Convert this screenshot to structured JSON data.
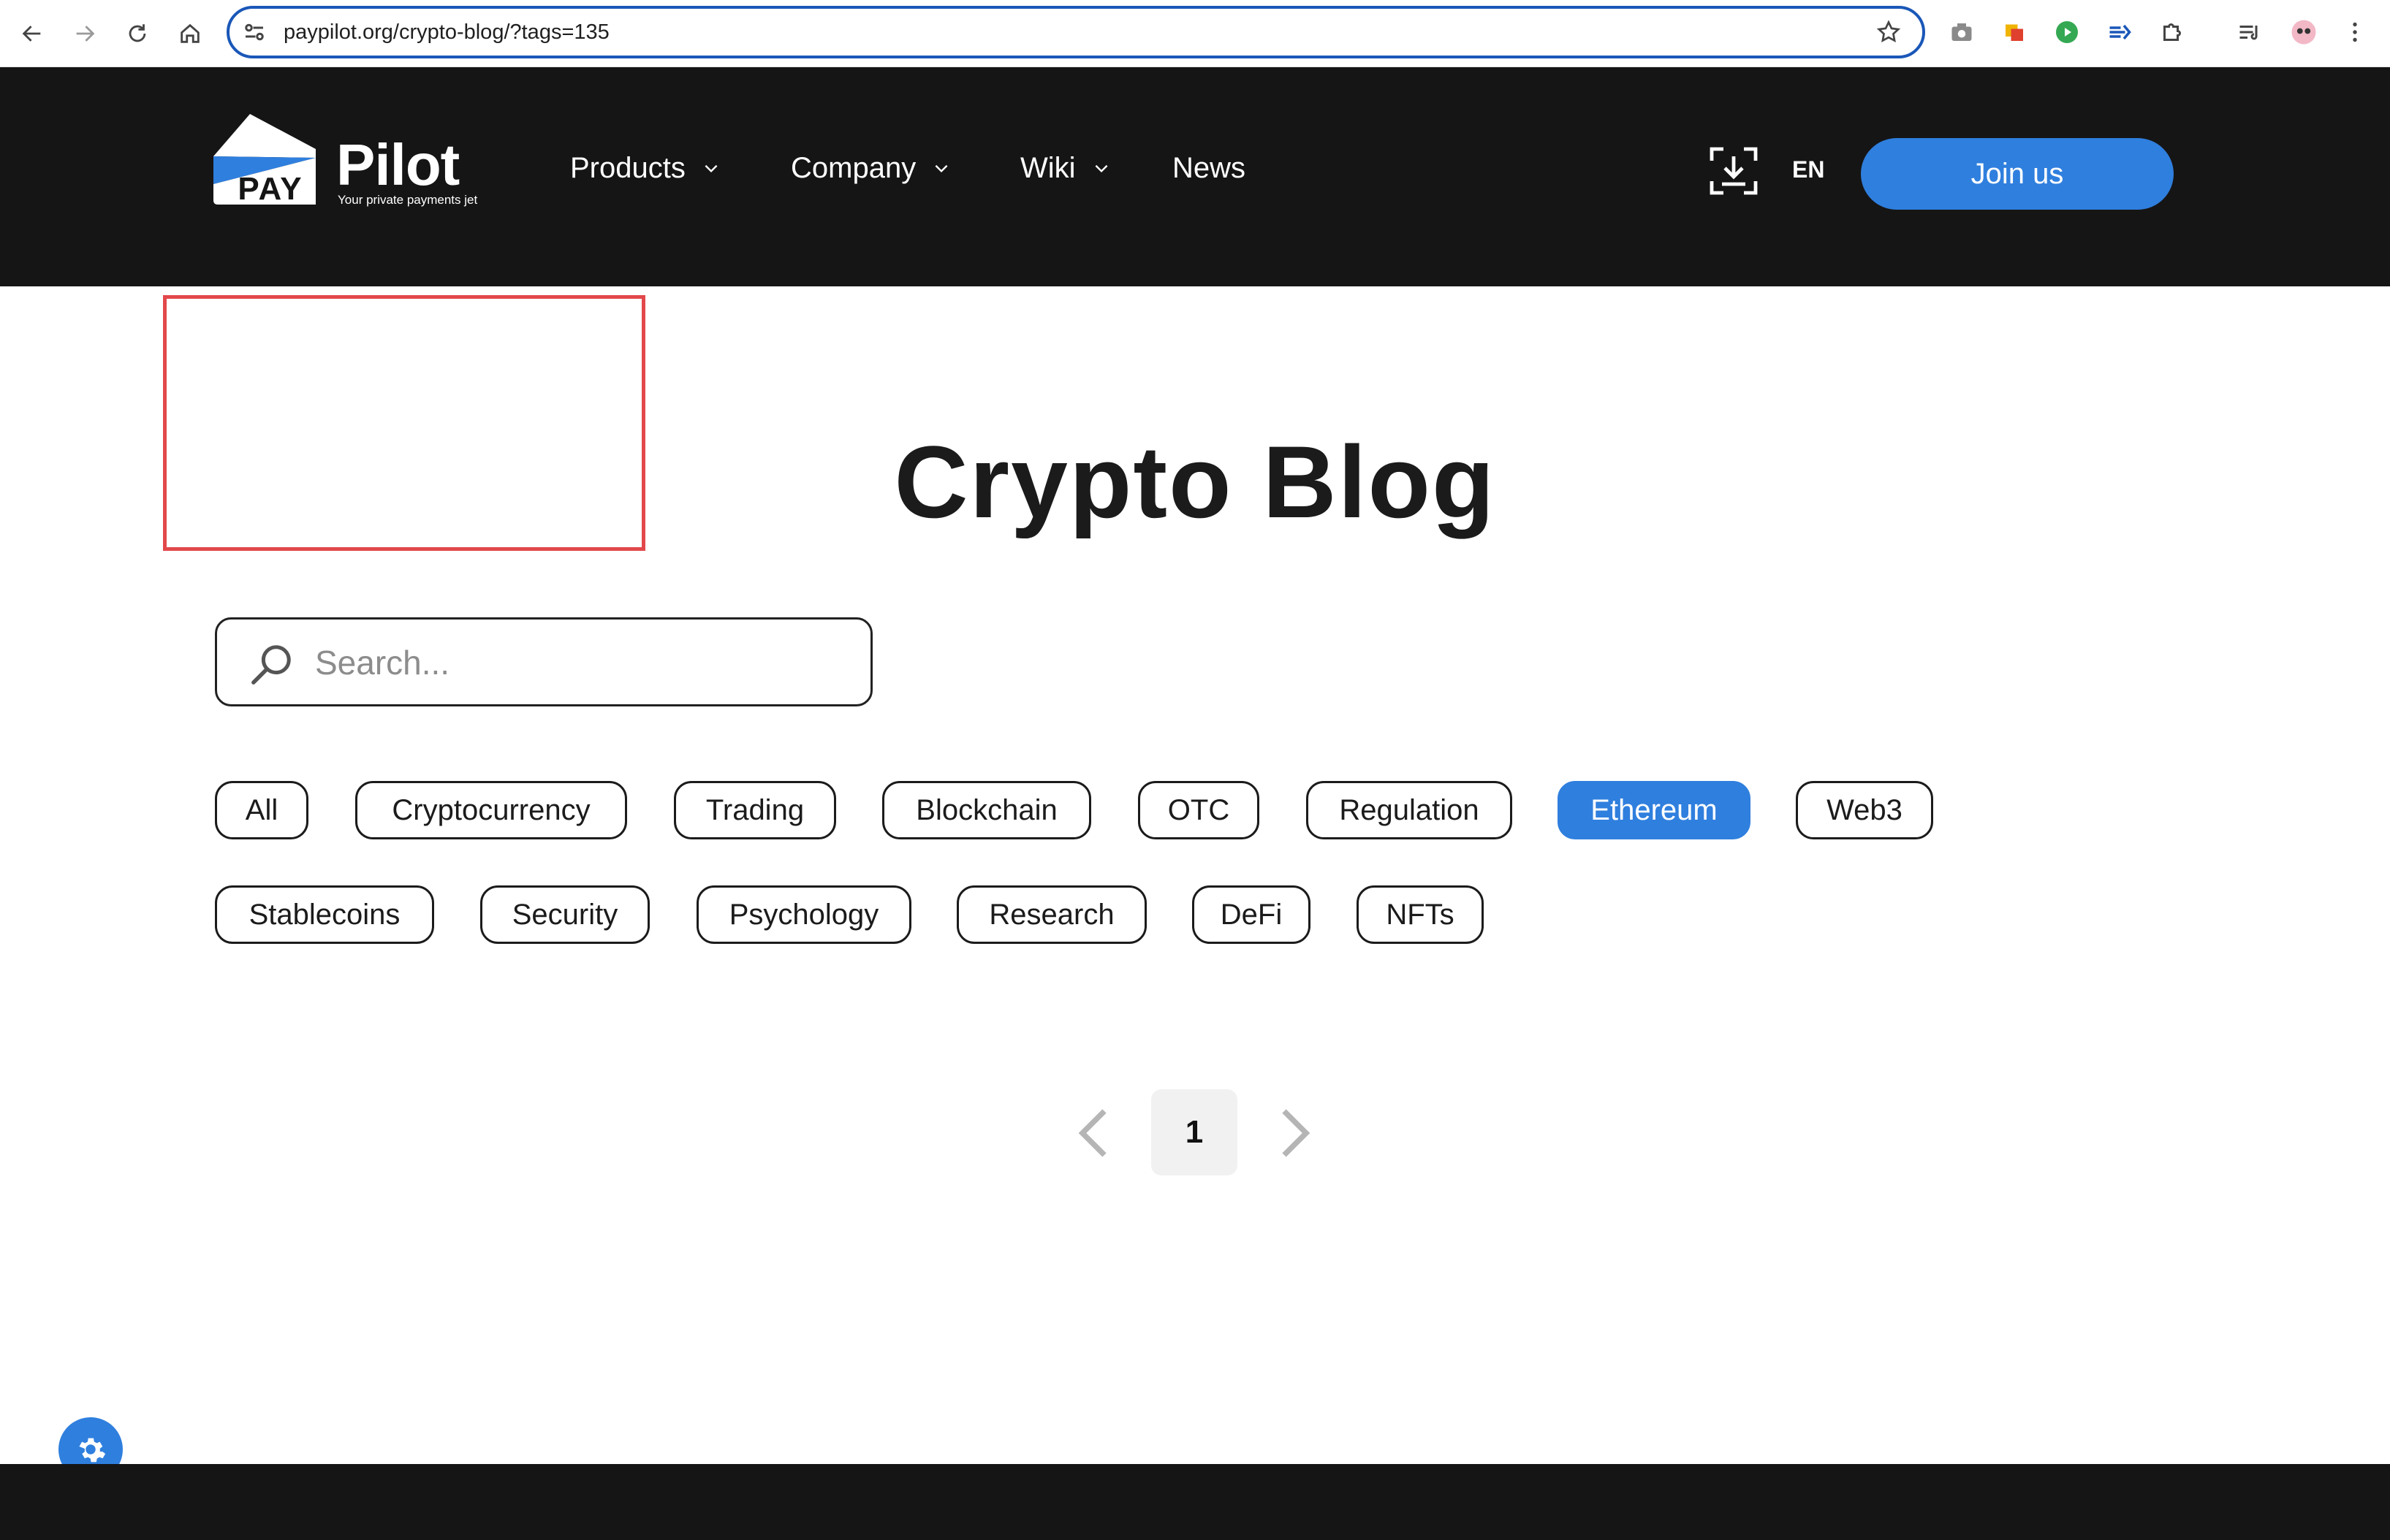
{
  "browser": {
    "url": "paypilot.org/crypto-blog/?tags=135"
  },
  "header": {
    "logo_badge": "PAY",
    "logo_word": "Pilot",
    "logo_tagline": "Your private payments jet",
    "nav": [
      {
        "label": "Products",
        "has_dropdown": true
      },
      {
        "label": "Company",
        "has_dropdown": true
      },
      {
        "label": "Wiki",
        "has_dropdown": true
      },
      {
        "label": "News",
        "has_dropdown": false
      }
    ],
    "language": "EN",
    "join_label": "Join us"
  },
  "main": {
    "title": "Crypto Blog",
    "search_placeholder": "Search...",
    "tags": [
      {
        "label": "All",
        "active": false
      },
      {
        "label": "Cryptocurrency",
        "active": false
      },
      {
        "label": "Trading",
        "active": false
      },
      {
        "label": "Blockchain",
        "active": false
      },
      {
        "label": "OTC",
        "active": false
      },
      {
        "label": "Regulation",
        "active": false
      },
      {
        "label": "Ethereum",
        "active": true
      },
      {
        "label": "Web3",
        "active": false
      },
      {
        "label": "Stablecoins",
        "active": false
      },
      {
        "label": "Security",
        "active": false
      },
      {
        "label": "Psychology",
        "active": false
      },
      {
        "label": "Research",
        "active": false
      },
      {
        "label": "DeFi",
        "active": false
      },
      {
        "label": "NFTs",
        "active": false
      }
    ],
    "pagination": {
      "current_page": "1"
    }
  },
  "colors": {
    "header_bg": "#151516",
    "accent": "#2f7fde",
    "highlight": "#e2484b"
  }
}
